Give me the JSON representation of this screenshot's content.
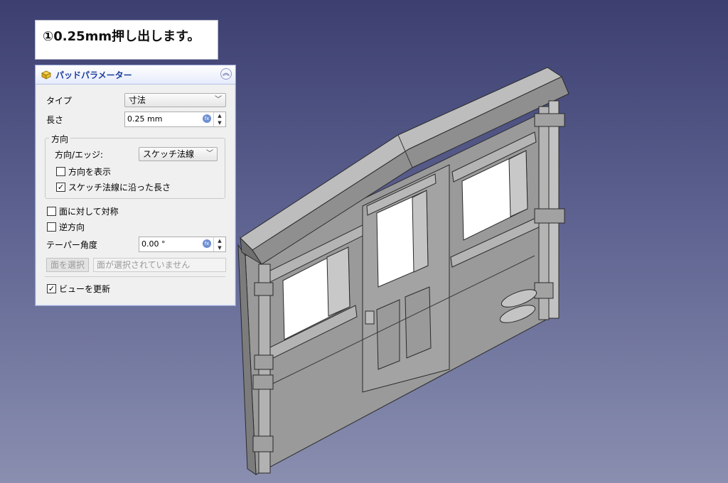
{
  "caption": "①0.25mm押し出します。",
  "panel": {
    "title": "パッドパラメーター",
    "type_label": "タイプ",
    "type_value": "寸法",
    "length_label": "長さ",
    "length_value": "0.25 mm",
    "direction_group": "方向",
    "direction_edge_label": "方向/エッジ:",
    "direction_edge_value": "スケッチ法線",
    "show_direction_label": "方向を表示",
    "show_direction_checked": false,
    "along_sketch_normal_label": "スケッチ法線に沿った長さ",
    "along_sketch_normal_checked": true,
    "symmetric_label": "面に対して対称",
    "symmetric_checked": false,
    "reversed_label": "逆方向",
    "reversed_checked": false,
    "taper_label": "テーパー角度",
    "taper_value": "0.00 °",
    "select_face_button": "面を選択",
    "face_status": "面が選択されていません",
    "update_view_label": "ビューを更新",
    "update_view_checked": true
  },
  "icons": {
    "title": "pad-feature-icon",
    "collapse": "collapse-chevron-icon",
    "expression": "expression-fx-icon"
  },
  "colors": {
    "panel_title": "#1b3d9c",
    "model_face": "#9c9c9c",
    "background_top": "#3c3f70",
    "background_bottom": "#8a8fb0"
  }
}
